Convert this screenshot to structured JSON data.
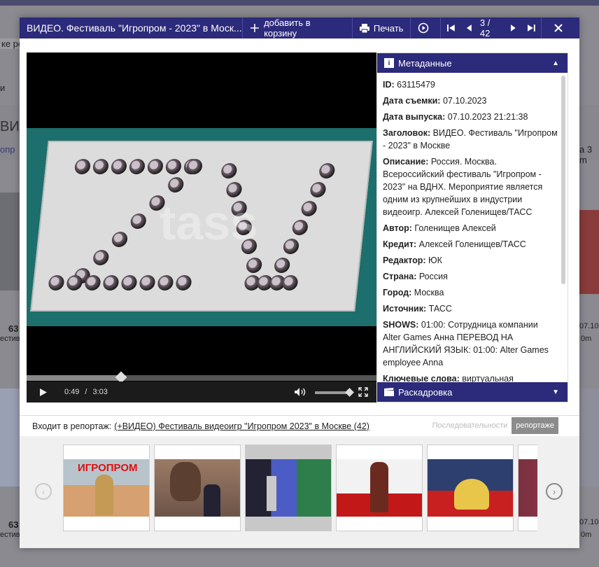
{
  "background": {
    "frag_1": "ке ре",
    "frag_2": "и",
    "frag_3": "ВИД",
    "frag_4": "опр",
    "frag_5": "63",
    "frag_6": "естива",
    "frag_7": "63",
    "frag_8": "естива",
    "frag_9": "а 3 m",
    "frag_10": "07.10.",
    "frag_11": "0m",
    "frag_12": "07.10.",
    "frag_13": "0m"
  },
  "header": {
    "title": "ВИДЕО. Фестиваль \"Игропром - 2023\" в Моск...",
    "add_to_cart": "добавить в корзину",
    "print": "Печать",
    "counter": "3 / 42"
  },
  "video": {
    "watermark": "tass",
    "current_time": "0:49",
    "divider": "/",
    "duration": "3:03",
    "progress_fraction": 0.27,
    "volume_fraction": 0.9
  },
  "metadata": {
    "heading": "Метаданные",
    "fields": [
      {
        "label": "ID:",
        "value": "63115479"
      },
      {
        "label": "Дата съемки:",
        "value": "07.10.2023"
      },
      {
        "label": "Дата выпуска:",
        "value": "07.10.2023 21:21:38"
      },
      {
        "label": "Заголовок:",
        "value": "ВИДЕО. Фестиваль \"Игропром - 2023\" в Москве"
      },
      {
        "label": "Описание:",
        "value": "Россия. Москва. Всероссийский фестиваль \"Игропром - 2023\" на ВДНХ. Мероприятие является одним из крупнейших в индустрии видеоигр. Алексей Голенищев/ТАСС"
      },
      {
        "label": "Автор:",
        "value": "Голенищев Алексей"
      },
      {
        "label": "Кредит:",
        "value": "Алексей Голенищев/ТАСС"
      },
      {
        "label": "Редактор:",
        "value": "ЮК"
      },
      {
        "label": "Страна:",
        "value": "Россия"
      },
      {
        "label": "Город:",
        "value": "Москва"
      },
      {
        "label": "Источник:",
        "value": "ТАСС"
      },
      {
        "label": "SHOWS:",
        "value": "01:00: Сотрудница компании Alter Games Анна ПЕРЕВОД НА АНГЛИЙСКИЙ ЯЗЫК: 01:00: Alter Games employee Anna"
      },
      {
        "label": "Ключевые слова:",
        "value": "виртуальная"
      }
    ],
    "storyboard": "Раскадровка"
  },
  "report": {
    "label": "Входит в репортаж:",
    "link": "(+ВИДЕО) Фестиваль видеоигр \"Игропром 2023\" в Москве (42)",
    "option_sequence": "Последовательности",
    "option_report": "репортаже"
  },
  "thumbnails": {
    "thumb1_text": "ИГРОПРОМ"
  },
  "colors": {
    "header_bg": "#2c2a7a",
    "accent": "#2c2a7a"
  }
}
